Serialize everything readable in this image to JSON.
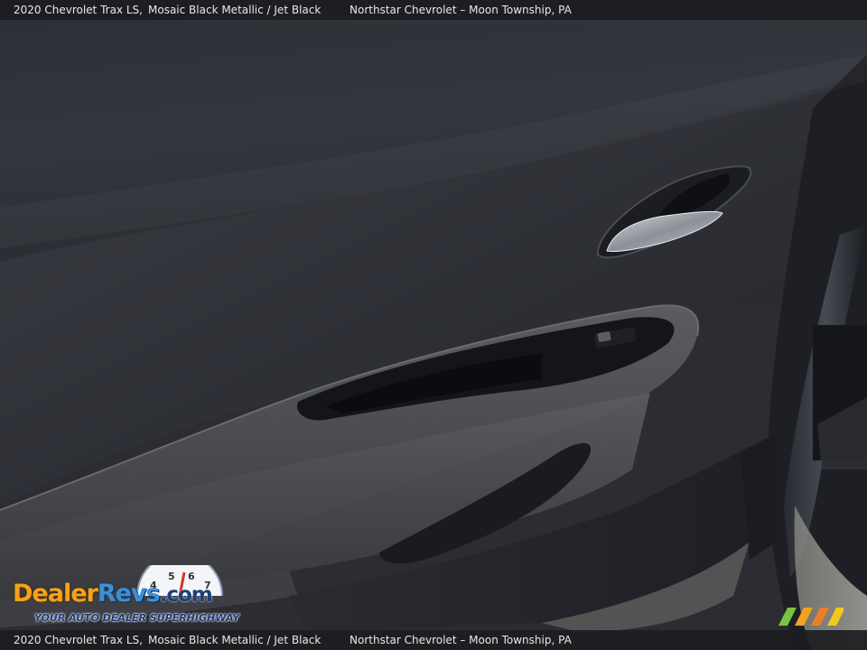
{
  "caption": {
    "vehicle": "2020 Chevrolet Trax LS,",
    "color": "Mosaic Black Metallic / Jet Black",
    "dealer": "Northstar Chevrolet – Moon Township, PA"
  },
  "watermark": {
    "word_dealer": "Dealer",
    "word_revs": "Revs",
    "word_com": ".com",
    "tagline": "YOUR AUTO DEALER SUPERHIGHWAY",
    "gauge_digits": [
      "4",
      "5",
      "6",
      "7"
    ],
    "stripe_colors": [
      "#7cc242",
      "#f4a21b",
      "#e8812a",
      "#f3c81b"
    ]
  },
  "colors": {
    "caption_bar": "#1c1d21",
    "panel": "#2b2d33",
    "armrest": "#4a4b4f"
  }
}
